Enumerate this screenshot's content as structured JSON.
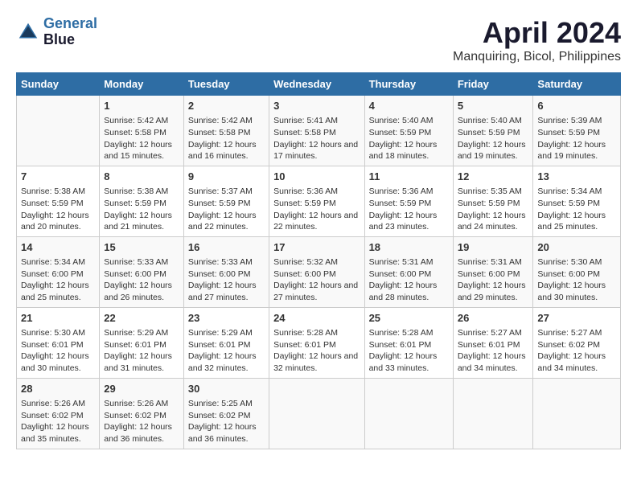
{
  "header": {
    "logo_line1": "General",
    "logo_line2": "Blue",
    "title": "April 2024",
    "subtitle": "Manquiring, Bicol, Philippines"
  },
  "days_of_week": [
    "Sunday",
    "Monday",
    "Tuesday",
    "Wednesday",
    "Thursday",
    "Friday",
    "Saturday"
  ],
  "weeks": [
    [
      {
        "day": "",
        "sunrise": "",
        "sunset": "",
        "daylight": ""
      },
      {
        "day": "1",
        "sunrise": "5:42 AM",
        "sunset": "5:58 PM",
        "daylight": "12 hours and 15 minutes."
      },
      {
        "day": "2",
        "sunrise": "5:42 AM",
        "sunset": "5:58 PM",
        "daylight": "12 hours and 16 minutes."
      },
      {
        "day": "3",
        "sunrise": "5:41 AM",
        "sunset": "5:58 PM",
        "daylight": "12 hours and 17 minutes."
      },
      {
        "day": "4",
        "sunrise": "5:40 AM",
        "sunset": "5:59 PM",
        "daylight": "12 hours and 18 minutes."
      },
      {
        "day": "5",
        "sunrise": "5:40 AM",
        "sunset": "5:59 PM",
        "daylight": "12 hours and 19 minutes."
      },
      {
        "day": "6",
        "sunrise": "5:39 AM",
        "sunset": "5:59 PM",
        "daylight": "12 hours and 19 minutes."
      }
    ],
    [
      {
        "day": "7",
        "sunrise": "5:38 AM",
        "sunset": "5:59 PM",
        "daylight": "12 hours and 20 minutes."
      },
      {
        "day": "8",
        "sunrise": "5:38 AM",
        "sunset": "5:59 PM",
        "daylight": "12 hours and 21 minutes."
      },
      {
        "day": "9",
        "sunrise": "5:37 AM",
        "sunset": "5:59 PM",
        "daylight": "12 hours and 22 minutes."
      },
      {
        "day": "10",
        "sunrise": "5:36 AM",
        "sunset": "5:59 PM",
        "daylight": "12 hours and 22 minutes."
      },
      {
        "day": "11",
        "sunrise": "5:36 AM",
        "sunset": "5:59 PM",
        "daylight": "12 hours and 23 minutes."
      },
      {
        "day": "12",
        "sunrise": "5:35 AM",
        "sunset": "5:59 PM",
        "daylight": "12 hours and 24 minutes."
      },
      {
        "day": "13",
        "sunrise": "5:34 AM",
        "sunset": "5:59 PM",
        "daylight": "12 hours and 25 minutes."
      }
    ],
    [
      {
        "day": "14",
        "sunrise": "5:34 AM",
        "sunset": "6:00 PM",
        "daylight": "12 hours and 25 minutes."
      },
      {
        "day": "15",
        "sunrise": "5:33 AM",
        "sunset": "6:00 PM",
        "daylight": "12 hours and 26 minutes."
      },
      {
        "day": "16",
        "sunrise": "5:33 AM",
        "sunset": "6:00 PM",
        "daylight": "12 hours and 27 minutes."
      },
      {
        "day": "17",
        "sunrise": "5:32 AM",
        "sunset": "6:00 PM",
        "daylight": "12 hours and 27 minutes."
      },
      {
        "day": "18",
        "sunrise": "5:31 AM",
        "sunset": "6:00 PM",
        "daylight": "12 hours and 28 minutes."
      },
      {
        "day": "19",
        "sunrise": "5:31 AM",
        "sunset": "6:00 PM",
        "daylight": "12 hours and 29 minutes."
      },
      {
        "day": "20",
        "sunrise": "5:30 AM",
        "sunset": "6:00 PM",
        "daylight": "12 hours and 30 minutes."
      }
    ],
    [
      {
        "day": "21",
        "sunrise": "5:30 AM",
        "sunset": "6:01 PM",
        "daylight": "12 hours and 30 minutes."
      },
      {
        "day": "22",
        "sunrise": "5:29 AM",
        "sunset": "6:01 PM",
        "daylight": "12 hours and 31 minutes."
      },
      {
        "day": "23",
        "sunrise": "5:29 AM",
        "sunset": "6:01 PM",
        "daylight": "12 hours and 32 minutes."
      },
      {
        "day": "24",
        "sunrise": "5:28 AM",
        "sunset": "6:01 PM",
        "daylight": "12 hours and 32 minutes."
      },
      {
        "day": "25",
        "sunrise": "5:28 AM",
        "sunset": "6:01 PM",
        "daylight": "12 hours and 33 minutes."
      },
      {
        "day": "26",
        "sunrise": "5:27 AM",
        "sunset": "6:01 PM",
        "daylight": "12 hours and 34 minutes."
      },
      {
        "day": "27",
        "sunrise": "5:27 AM",
        "sunset": "6:02 PM",
        "daylight": "12 hours and 34 minutes."
      }
    ],
    [
      {
        "day": "28",
        "sunrise": "5:26 AM",
        "sunset": "6:02 PM",
        "daylight": "12 hours and 35 minutes."
      },
      {
        "day": "29",
        "sunrise": "5:26 AM",
        "sunset": "6:02 PM",
        "daylight": "12 hours and 36 minutes."
      },
      {
        "day": "30",
        "sunrise": "5:25 AM",
        "sunset": "6:02 PM",
        "daylight": "12 hours and 36 minutes."
      },
      {
        "day": "",
        "sunrise": "",
        "sunset": "",
        "daylight": ""
      },
      {
        "day": "",
        "sunrise": "",
        "sunset": "",
        "daylight": ""
      },
      {
        "day": "",
        "sunrise": "",
        "sunset": "",
        "daylight": ""
      },
      {
        "day": "",
        "sunrise": "",
        "sunset": "",
        "daylight": ""
      }
    ]
  ]
}
